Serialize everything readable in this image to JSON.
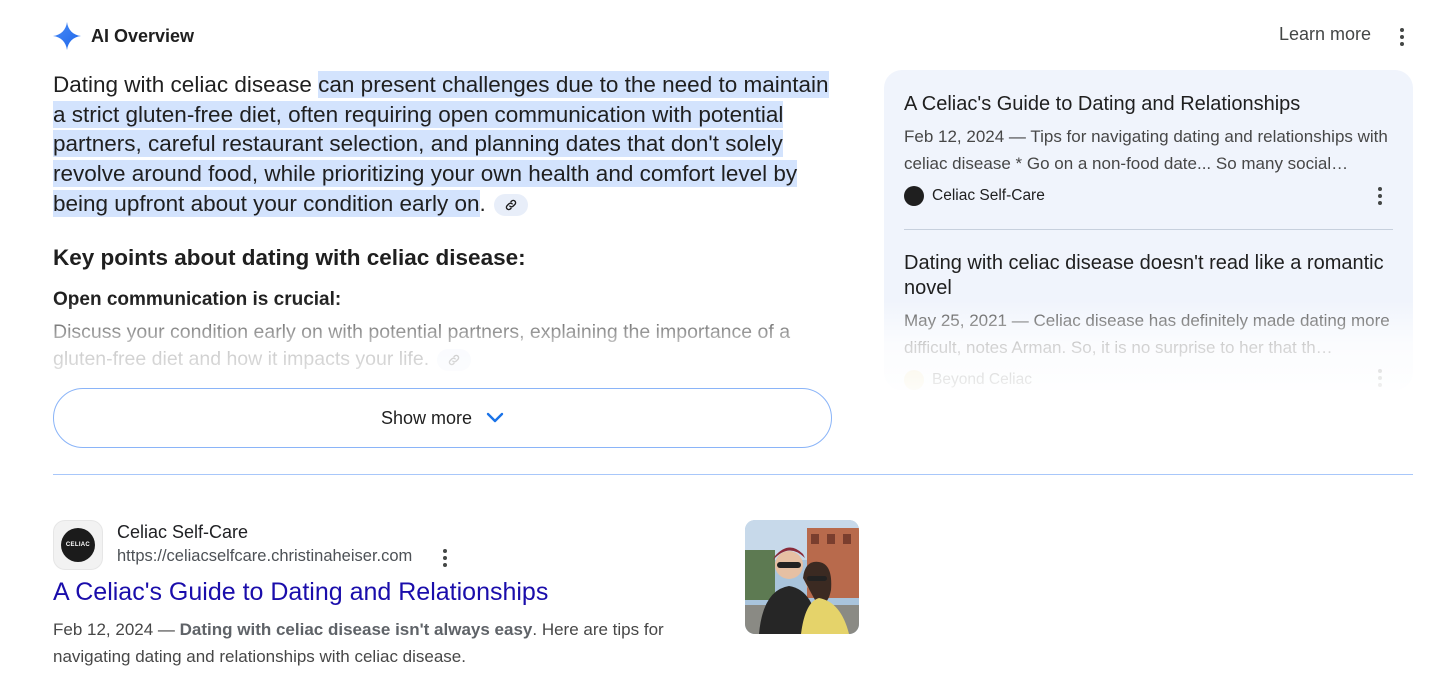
{
  "header": {
    "title": "AI Overview",
    "learn_more": "Learn more"
  },
  "overview": {
    "lead": "Dating with celiac disease",
    "highlighted": "can present challenges due to the need to maintain a strict gluten-free diet, often requiring open communication with potential partners, careful restaurant selection, and planning dates that don't solely revolve around food, while prioritizing your own health and comfort level by being upfront about your condition early on",
    "end": ".",
    "key_points_heading": "Key points about dating with celiac disease:",
    "point_title": "Open communication is crucial:",
    "point_text": "Discuss your condition early on with potential partners, explaining the importance of a gluten-free diet and how it impacts your life."
  },
  "show_more_label": "Show more",
  "sources": [
    {
      "title": "A Celiac's Guide to Dating and Relationships",
      "snippet": "Feb 12, 2024 — Tips for navigating dating and relationships with celiac disease * Go on a non-food date... So many social…",
      "site": "Celiac Self-Care"
    },
    {
      "title": "Dating with celiac disease doesn't read like a romantic novel",
      "snippet": "May 25, 2021 — Celiac disease has definitely made dating more difficult, notes Arman. So, it is no surprise to her that th…",
      "site": "Beyond Celiac"
    }
  ],
  "result": {
    "site_name": "Celiac Self-Care",
    "url": "https://celiacselfcare.christinaheiser.com",
    "title": "A Celiac's Guide to Dating and Relationships",
    "date": "Feb 12, 2024",
    "dash": " — ",
    "snippet_bold": "Dating with celiac disease isn't always easy",
    "snippet_rest": ". Here are tips for navigating dating and relationships with celiac disease.",
    "favicon_text": "CELIAC"
  },
  "colors": {
    "accent_blue": "#1a73e8",
    "highlight": "#d3e3fd",
    "link": "#1a0dab",
    "panel_bg": "#f0f4fc"
  },
  "icons": [
    "gemini-sparkle-icon",
    "more-vert-icon",
    "link-icon",
    "chevron-down-icon"
  ]
}
